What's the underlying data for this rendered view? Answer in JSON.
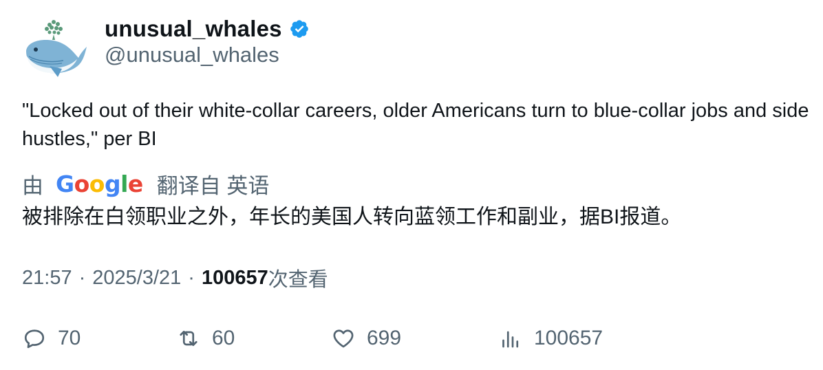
{
  "author": {
    "display_name": "unusual_whales",
    "handle": "@unusual_whales",
    "avatar_icon": "whale-avatar-icon",
    "verified": true,
    "verified_color": "#1d9bf0"
  },
  "tweet": {
    "text": "\"Locked out of their white-collar careers, older Americans turn to blue-collar jobs and side hustles,\" per BI"
  },
  "translation": {
    "prefix": "由",
    "provider_logo_text": "Google",
    "translated_from": "翻译自 英语",
    "text": "被排除在白领职业之外，年长的美国人转向蓝领工作和副业，据BI报道。"
  },
  "meta": {
    "time": "21:57",
    "separator": "·",
    "date": "2025/3/21",
    "views_count": "100657",
    "views_label": "次查看"
  },
  "actions": {
    "reply_count": "70",
    "retweet_count": "60",
    "like_count": "699",
    "views_count": "100657"
  },
  "colors": {
    "text_primary": "#0f1419",
    "text_secondary": "#536471"
  }
}
